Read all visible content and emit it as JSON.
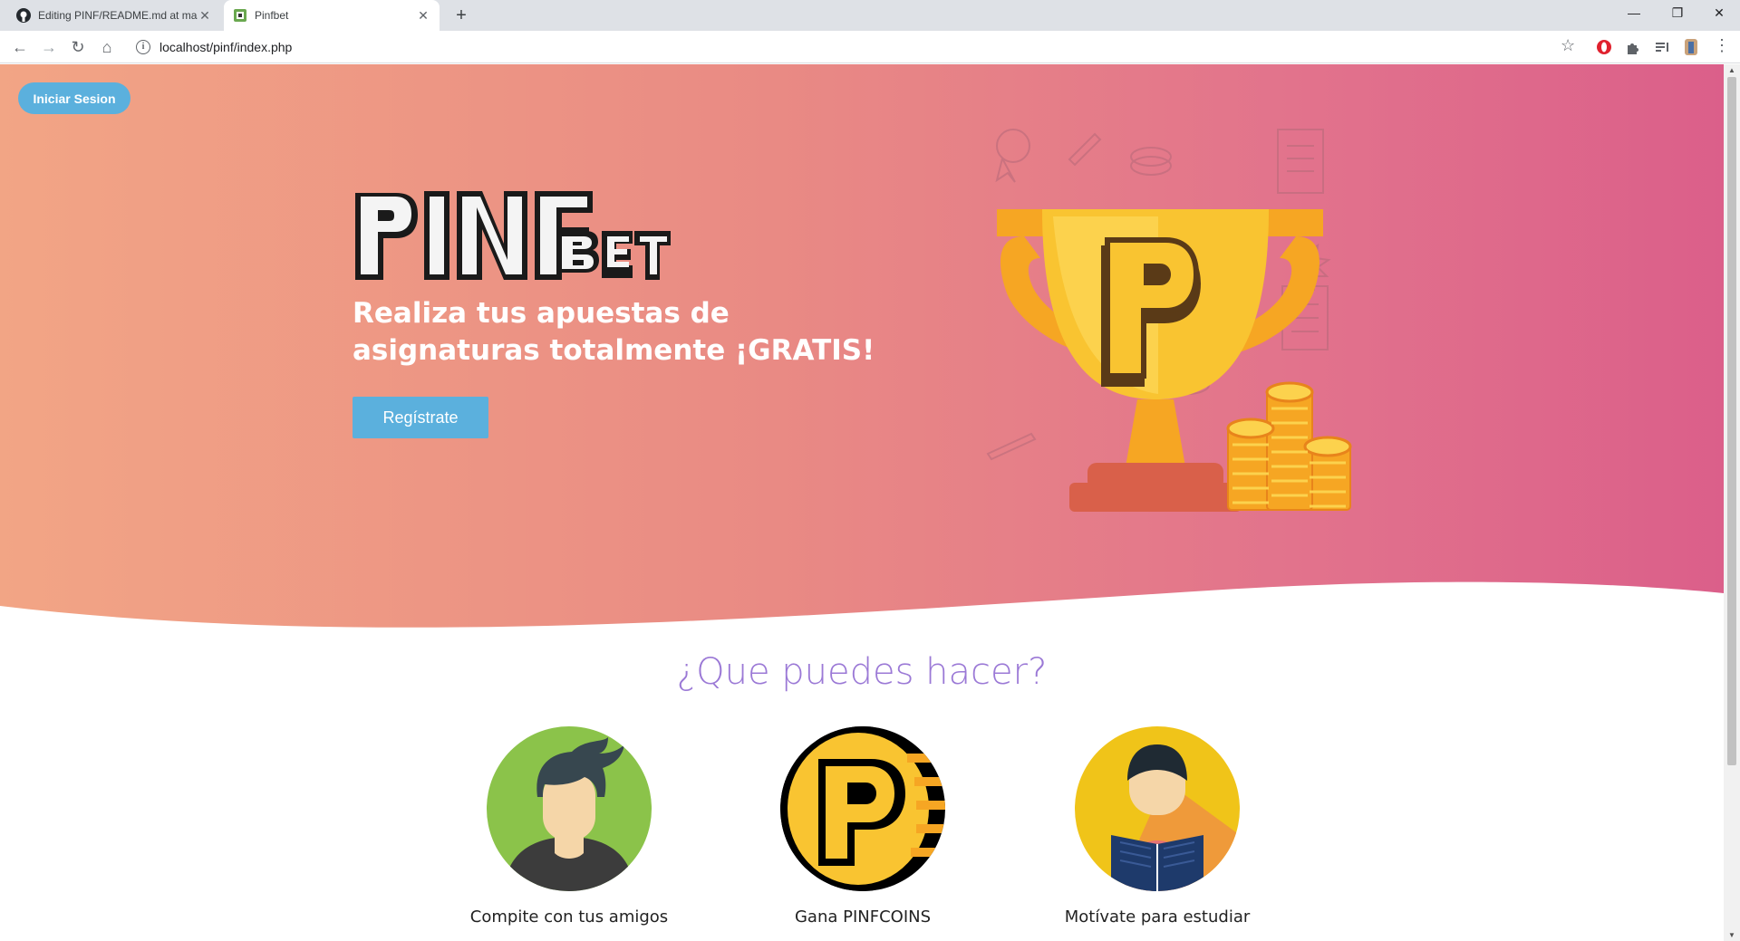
{
  "browser": {
    "tabs": [
      {
        "title": "Editing PINF/README.md at mas",
        "active": false,
        "icon": "github-icon"
      },
      {
        "title": "Pinfbet",
        "active": true,
        "icon": "pinfbet-favicon"
      }
    ],
    "url": "localhost/pinf/index.php"
  },
  "hero": {
    "login_label": "Iniciar Sesion",
    "tagline": "Realiza tus apuestas de asignaturas totalmente ¡GRATIS!",
    "register_label": "Regístrate",
    "gradient": [
      "#f2a585",
      "#db5f8a"
    ]
  },
  "features": {
    "title": "¿Que puedes hacer?",
    "items": [
      {
        "caption": "Compite con tus amigos",
        "icon": "friend-avatar-icon",
        "color": "#8bc34a"
      },
      {
        "caption": "Gana PINFCOINS",
        "icon": "pinfcoin-icon",
        "color": "#f9c431"
      },
      {
        "caption": "Motívate para estudiar",
        "icon": "student-reading-icon",
        "color": "#f0c419"
      }
    ]
  },
  "colors": {
    "accent_button": "#5bb0dd",
    "section_title": "#9b79d6"
  }
}
